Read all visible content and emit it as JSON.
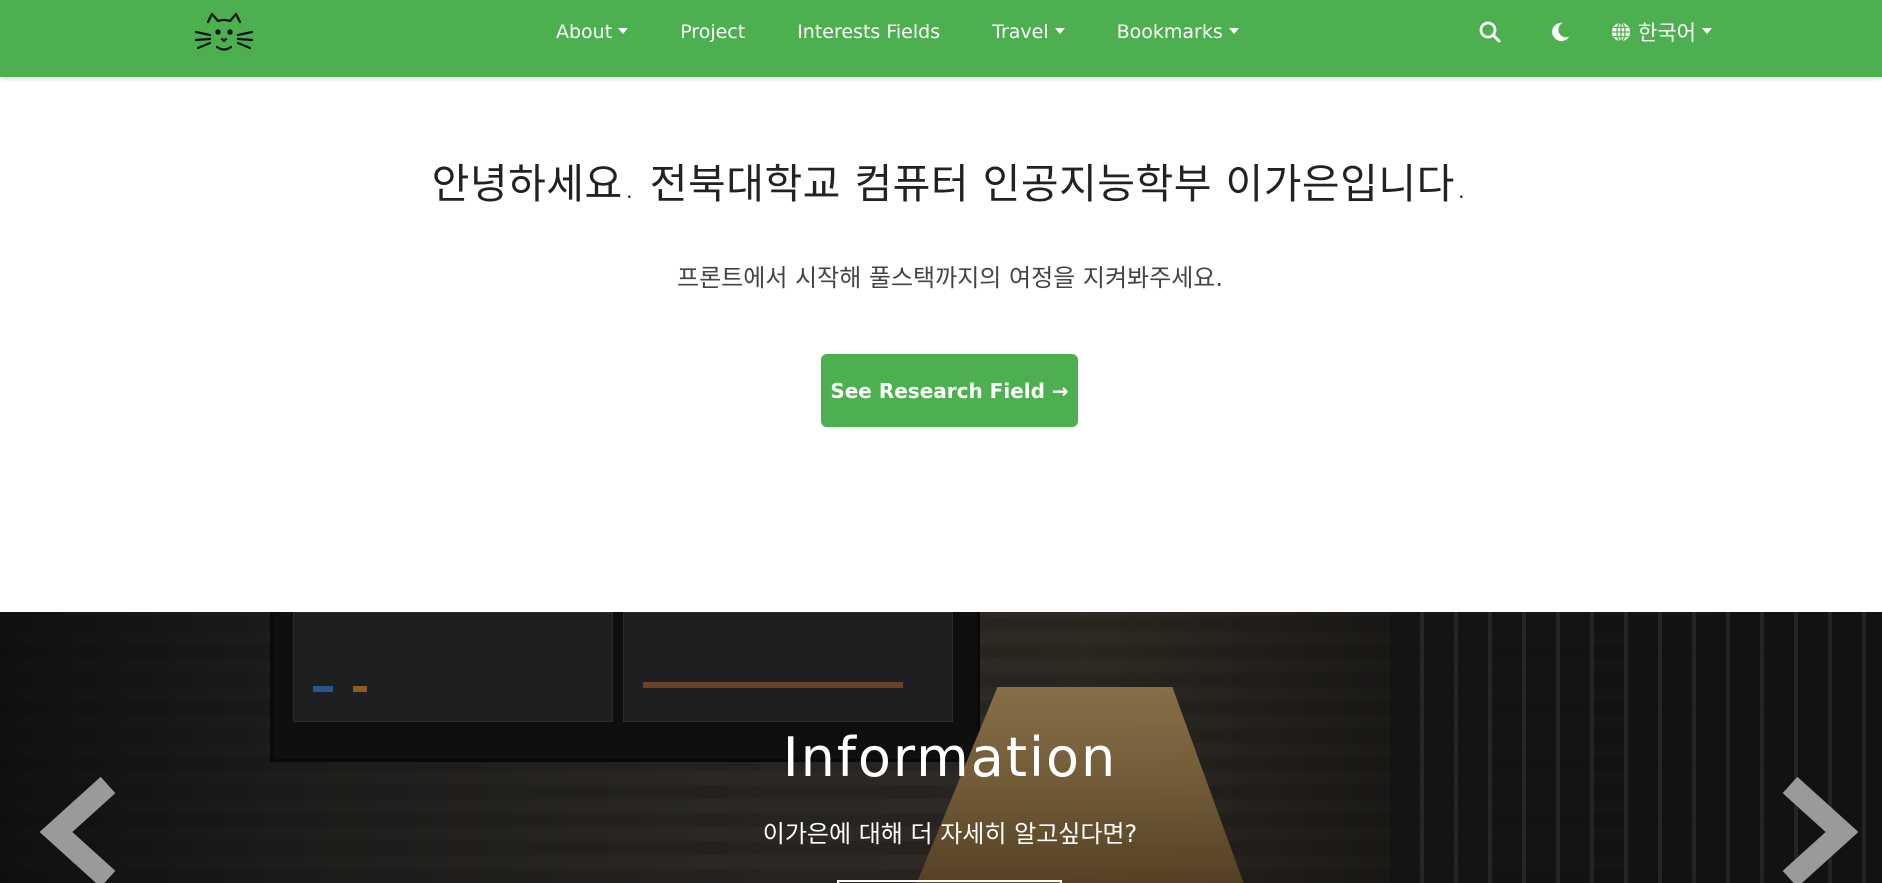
{
  "navbar": {
    "items": [
      {
        "label": "About",
        "dropdown": true
      },
      {
        "label": "Project",
        "dropdown": false
      },
      {
        "label": "Interests Fields",
        "dropdown": false
      },
      {
        "label": "Travel",
        "dropdown": true
      },
      {
        "label": "Bookmarks",
        "dropdown": true
      }
    ],
    "language": "한국어",
    "icons": [
      "cat-logo-icon",
      "search-icon",
      "moon-icon",
      "globe-icon"
    ]
  },
  "hero": {
    "title": "안녕하세요. 전북대학교 컴퓨터 인공지능학부 이가은입니다.",
    "subtitle": "프론트에서 시작해 풀스택까지의 여정을 지켜봐주세요.",
    "cta_label": "See Research Field →"
  },
  "carousel": {
    "title": "Information",
    "subtitle": "이가은에 대해 더 자세히 알고싶다면?"
  },
  "colors": {
    "accent": "#4caf50",
    "text": "#222222"
  }
}
